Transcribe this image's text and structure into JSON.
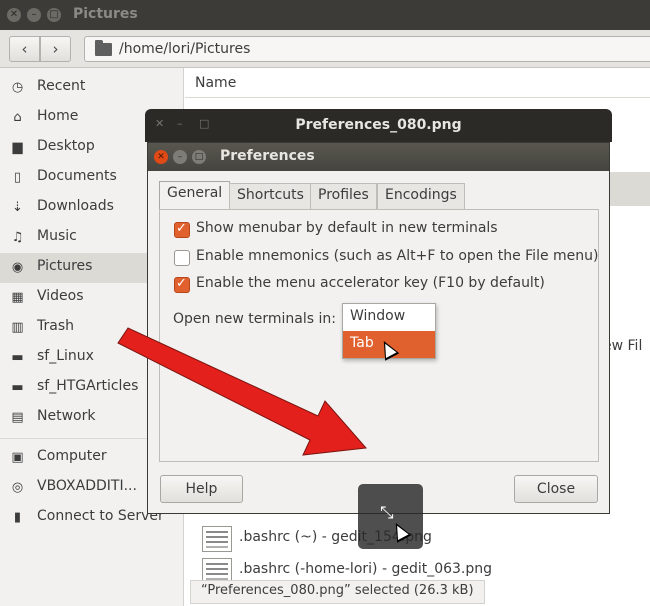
{
  "file_manager": {
    "title": "Pictures",
    "path": "/home/lori/Pictures",
    "column_name": "Name",
    "truncated_right_text": "ew Fil",
    "status": "“Preferences_080.png” selected  (26.3 kB)"
  },
  "sidebar": {
    "items": [
      {
        "label": "Recent",
        "icon": "clock-icon"
      },
      {
        "label": "Home",
        "icon": "home-icon"
      },
      {
        "label": "Desktop",
        "icon": "folder-icon"
      },
      {
        "label": "Documents",
        "icon": "document-icon"
      },
      {
        "label": "Downloads",
        "icon": "download-icon"
      },
      {
        "label": "Music",
        "icon": "music-icon"
      },
      {
        "label": "Pictures",
        "icon": "camera-icon"
      },
      {
        "label": "Videos",
        "icon": "film-icon"
      },
      {
        "label": "Trash",
        "icon": "trash-icon"
      },
      {
        "label": "sf_Linux",
        "icon": "drive-icon"
      },
      {
        "label": "sf_HTGArticles",
        "icon": "drive-icon"
      },
      {
        "label": "Network",
        "icon": "network-icon"
      },
      {
        "label": "Computer",
        "icon": "computer-icon"
      },
      {
        "label": "VBOXADDITI...",
        "icon": "disc-icon"
      },
      {
        "label": "Connect to Server",
        "icon": "server-icon"
      }
    ]
  },
  "files": [
    {
      "name": ".bashrc (~) - gedit_154.png"
    },
    {
      "name": ".bashrc (-home-lori) - gedit_063.png"
    }
  ],
  "terminal_window": {
    "title": "Preferences_080.png"
  },
  "preferences": {
    "title": "Preferences",
    "tabs": [
      "General",
      "Shortcuts",
      "Profiles",
      "Encodings"
    ],
    "options": [
      {
        "label": "Show menubar by default in new terminals",
        "checked": true
      },
      {
        "label": "Enable mnemonics (such as Alt+F to open the File menu)",
        "checked": false
      },
      {
        "label": "Enable the menu accelerator key (F10 by default)",
        "checked": true
      }
    ],
    "open_new_label": "Open new terminals in:",
    "dropdown_options": [
      "Window",
      "Tab"
    ],
    "help_button": "Help",
    "close_button": "Close"
  },
  "colors": {
    "accent": "#e0612e",
    "arrow": "#e3201b",
    "titlebar": "#3c3b37"
  }
}
